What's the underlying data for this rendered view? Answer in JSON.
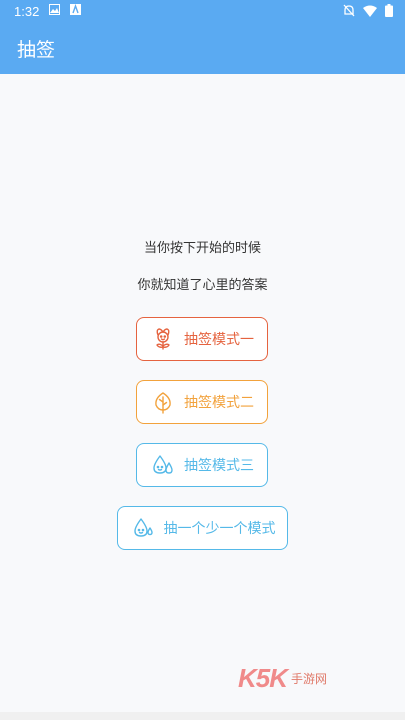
{
  "status_bar": {
    "time": "1:32",
    "icons": [
      "image-icon",
      "text-icon",
      "mute-icon",
      "wifi-icon",
      "battery-icon"
    ]
  },
  "app_bar": {
    "title": "抽签"
  },
  "taglines": [
    "当你按下开始的时候",
    "你就知道了心里的答案"
  ],
  "buttons": [
    {
      "label": "抽签模式一",
      "icon": "flower-icon",
      "color": "#e5633f"
    },
    {
      "label": "抽签模式二",
      "icon": "leaf-icon",
      "color": "#f2a23c"
    },
    {
      "label": "抽签模式三",
      "icon": "water-drops-icon",
      "color": "#55b9e8"
    },
    {
      "label": "抽一个少一个模式",
      "icon": "water-drop-icon",
      "color": "#55b9e8"
    }
  ],
  "watermark": {
    "brand": "K5K",
    "text": "手游网",
    "color": "#f08a8a"
  },
  "colors": {
    "primary": "#5aaaf2",
    "background": "#f8f9fb"
  }
}
